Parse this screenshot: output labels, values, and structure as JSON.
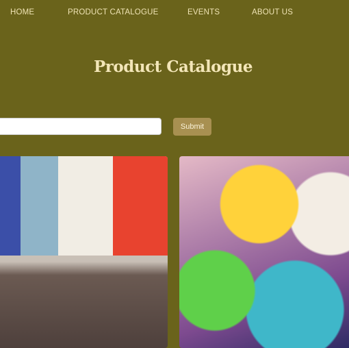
{
  "nav": {
    "items": [
      "HOME",
      "PRODUCT CATALOGUE",
      "EVENTS",
      "ABOUT US"
    ]
  },
  "header": {
    "title": "Product Catalogue"
  },
  "search": {
    "value": "",
    "submit_label": "Submit"
  },
  "products": [
    {
      "image": "books-on-shelf"
    },
    {
      "image": "plush-toys"
    }
  ],
  "colors": {
    "background": "#6a631b",
    "nav_text": "#efe3b4",
    "submit": "#a89051"
  }
}
